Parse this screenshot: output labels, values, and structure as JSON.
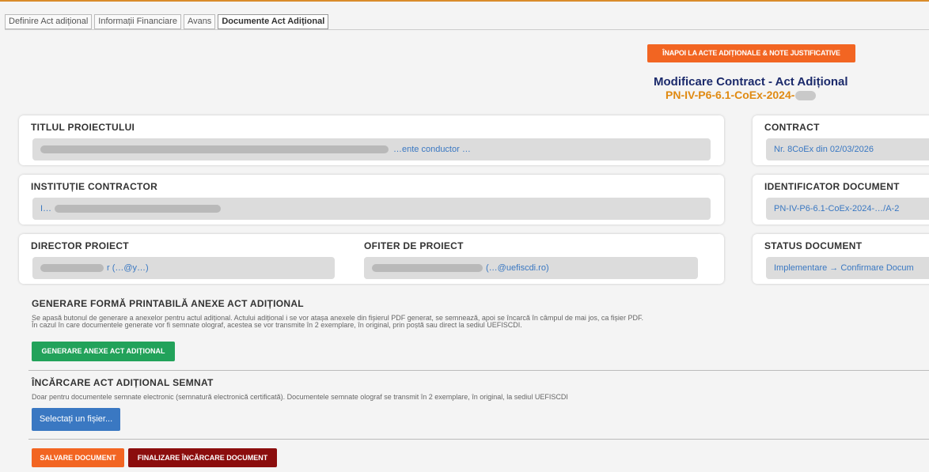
{
  "tabs": [
    {
      "label": "Definire Act adițional"
    },
    {
      "label": "Informații Financiare"
    },
    {
      "label": "Avans"
    },
    {
      "label": "Documente Act Adițional"
    }
  ],
  "header": {
    "back_button": "ÎNAPOI LA ACTE ADIȚIONALE & NOTE JUSTIFICATIVE",
    "title": "Modificare Contract - Act Adițional",
    "code": "PN-IV-P6-6.1-CoEx-2024-"
  },
  "cards": {
    "titlu": {
      "label": "TITLUL PROIECTULUI",
      "value": "…ente conductor …"
    },
    "contract": {
      "label": "CONTRACT",
      "value": "Nr. 8CoEx din 02/03/2026"
    },
    "institutie": {
      "label": "INSTITUȚIE CONTRACTOR",
      "value": "I…"
    },
    "identificator": {
      "label": "IDENTIFICATOR DOCUMENT",
      "value": "PN-IV-P6-6.1-CoEx-2024-…/A-2"
    },
    "director": {
      "label": "DIRECTOR PROIECT",
      "value": "r (…@y…)"
    },
    "ofiter": {
      "label": "OFITER DE PROIECT",
      "value": "(…@uefiscdi.ro)"
    },
    "status": {
      "label": "STATUS DOCUMENT",
      "value": "Implementare → Confirmare Docum"
    }
  },
  "generare": {
    "title": "GENERARE FORMĂ PRINTABILĂ ANEXE ACT ADIȚIONAL",
    "desc1": "Se apasă butonul de generare a anexelor pentru actul adițional. Actului adițional i se vor atașa anexele din fișierul PDF generat, se semnează, apoi se încarcă în câmpul de mai jos, ca fișier PDF.",
    "desc2": "În cazul în care documentele generate vor fi semnate olograf, acestea se vor transmite în 2 exemplare, în original, prin poștă sau direct la sediul UEFISCDI.",
    "button": "GENERARE ANEXE ACT ADIȚIONAL"
  },
  "incarcare": {
    "title": "ÎNCĂRCARE ACT ADIȚIONAL SEMNAT",
    "desc": "Doar pentru documentele semnate electronic (semnatură electronică certificată). Documentele semnate olograf se transmit în 2 exemplare, în original, la sediul UEFISCDI",
    "button": "Selectați un fișier..."
  },
  "actions": {
    "save": "SALVARE DOCUMENT",
    "finalize": "FINALIZARE ÎNCĂRCARE DOCUMENT"
  },
  "colors": {
    "accent_orange": "#f26522",
    "title_navy": "#1b2a6b",
    "code_orange": "#e08a12",
    "green": "#22a25a",
    "blue": "#3a78c2",
    "dark_red": "#8b0d0d"
  }
}
